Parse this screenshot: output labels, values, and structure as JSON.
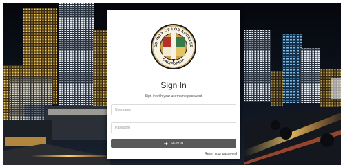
{
  "login": {
    "title": "Sign In",
    "subtitle": "Sign in with your username/password",
    "username_placeholder": "Username",
    "password_placeholder": "Password",
    "sign_in_label": "SIGN IN",
    "reset_link": "Reset your password"
  },
  "seal": {
    "top_text": "COUNTY OF LOS ANGELES",
    "bottom_text": "CALIFORNIA"
  },
  "colors": {
    "button": "#595959",
    "card": "#ffffff",
    "seal_ring": "#1d1d1d",
    "seal_gold": "#c9a24a"
  },
  "icons": {
    "sign_in": "sign-in-icon",
    "background": "city-night-skyline"
  }
}
